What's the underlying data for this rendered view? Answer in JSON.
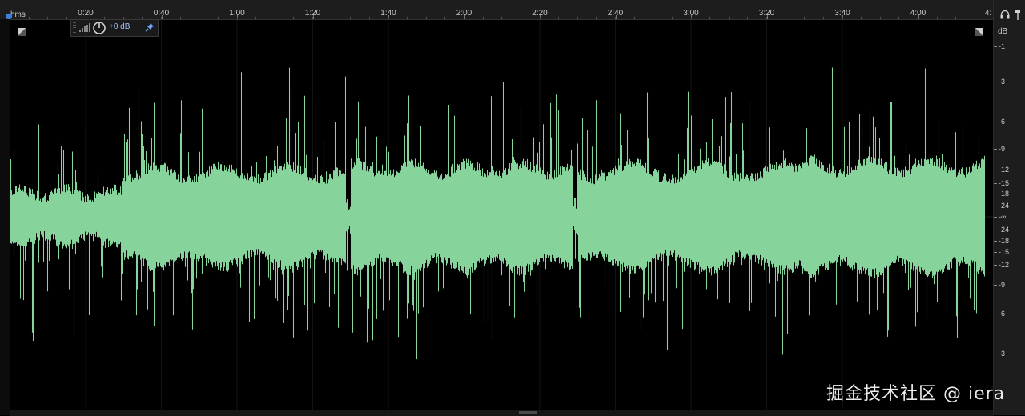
{
  "ruler": {
    "unit_label": "hms",
    "labels": [
      "0:20",
      "0:40",
      "1:00",
      "1:20",
      "1:40",
      "2:00",
      "2:20",
      "2:40",
      "3:00",
      "3:20",
      "3:40",
      "4:00",
      "4:"
    ]
  },
  "hud": {
    "volume_value": "+0 dB"
  },
  "db_scale": {
    "unit": "dB",
    "labels": [
      "-1",
      "-3",
      "-6",
      "-9",
      "-12",
      "-15",
      "-18",
      "-24",
      "-∞",
      "-24",
      "-18",
      "-15",
      "-12",
      "-9",
      "-6",
      "-3"
    ]
  },
  "waveform": {
    "color": "#86d39c"
  },
  "watermark": "掘金技术社区 @ iera"
}
